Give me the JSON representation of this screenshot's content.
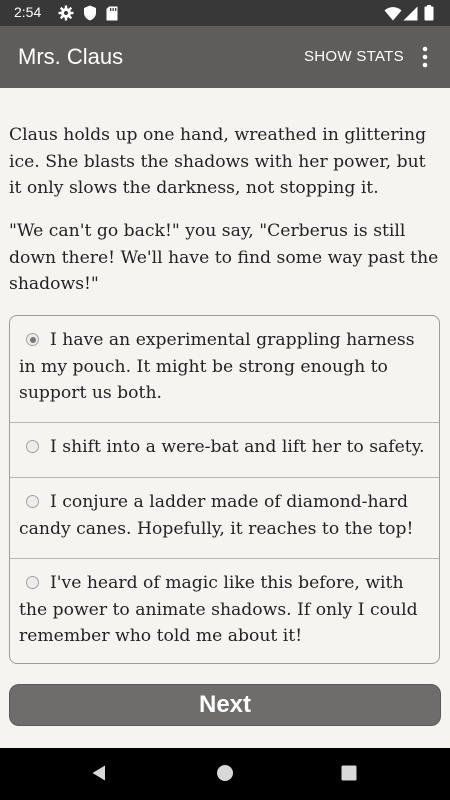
{
  "status_bar": {
    "time": "2:54",
    "left_icons": [
      "gear-icon",
      "shield-icon",
      "sd-card-icon"
    ],
    "right_icons": [
      "wifi-icon",
      "signal-icon",
      "battery-icon"
    ]
  },
  "app_bar": {
    "title": "Mrs. Claus",
    "show_stats_label": "SHOW STATS",
    "more_icon": "more-vert-icon"
  },
  "story": {
    "paragraphs": [
      "Claus holds up one hand, wreathed in glittering ice. She blasts the shadows with her power, but it only slows the darkness, not stopping it.",
      "\"We can't go back!\" you say, \"Cerberus is still down there! We'll have to find some way past the shadows!\""
    ]
  },
  "choices": {
    "selected_index": 0,
    "items": [
      {
        "label": "I have an experimental grappling harness in my pouch. It might be strong enough to support us both."
      },
      {
        "label": "I shift into a were-bat and lift her to safety."
      },
      {
        "label": "I conjure a ladder made of diamond-hard candy canes. Hopefully, it reaches to the top!"
      },
      {
        "label": "I've heard of magic like this before, with the power to animate shadows. If only I could remember who told me about it!"
      }
    ]
  },
  "next_button": {
    "label": "Next"
  },
  "nav_bar": {
    "icons": [
      "back-icon",
      "home-icon",
      "recents-icon"
    ]
  }
}
